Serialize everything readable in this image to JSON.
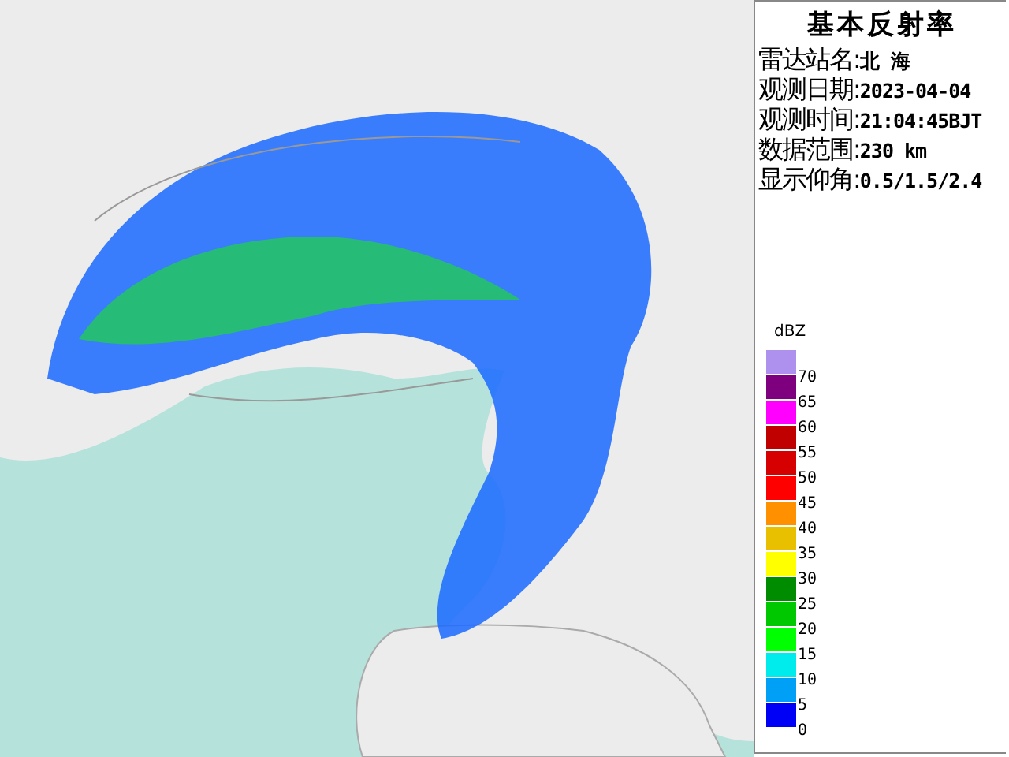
{
  "title": "基本反射率",
  "info": [
    {
      "label": "雷达站名:",
      "value": "北 海"
    },
    {
      "label": "观测日期:",
      "value": "2023-04-04"
    },
    {
      "label": "观测时间:",
      "value": "21:04:45BJT"
    },
    {
      "label": "数据范围:",
      "value": "230 km"
    },
    {
      "label": "显示仰角:",
      "value": "0.5/1.5/2.4"
    }
  ],
  "legend": {
    "unit": "dBZ",
    "items": [
      {
        "label": "70",
        "color": "#ae90ee"
      },
      {
        "label": "65",
        "color": "#7e007e"
      },
      {
        "label": "60",
        "color": "#ff00ff"
      },
      {
        "label": "55",
        "color": "#c00000"
      },
      {
        "label": "50",
        "color": "#d60000"
      },
      {
        "label": "45",
        "color": "#ff0000"
      },
      {
        "label": "40",
        "color": "#ff9000"
      },
      {
        "label": "35",
        "color": "#e8c000"
      },
      {
        "label": "30",
        "color": "#ffff00"
      },
      {
        "label": "25",
        "color": "#008c00"
      },
      {
        "label": "20",
        "color": "#00c800"
      },
      {
        "label": "15",
        "color": "#00ff00"
      },
      {
        "label": "10",
        "color": "#00ecec"
      },
      {
        "label": "5",
        "color": "#00a0f6"
      },
      {
        "label": "0",
        "color": "#0000f6"
      }
    ]
  }
}
